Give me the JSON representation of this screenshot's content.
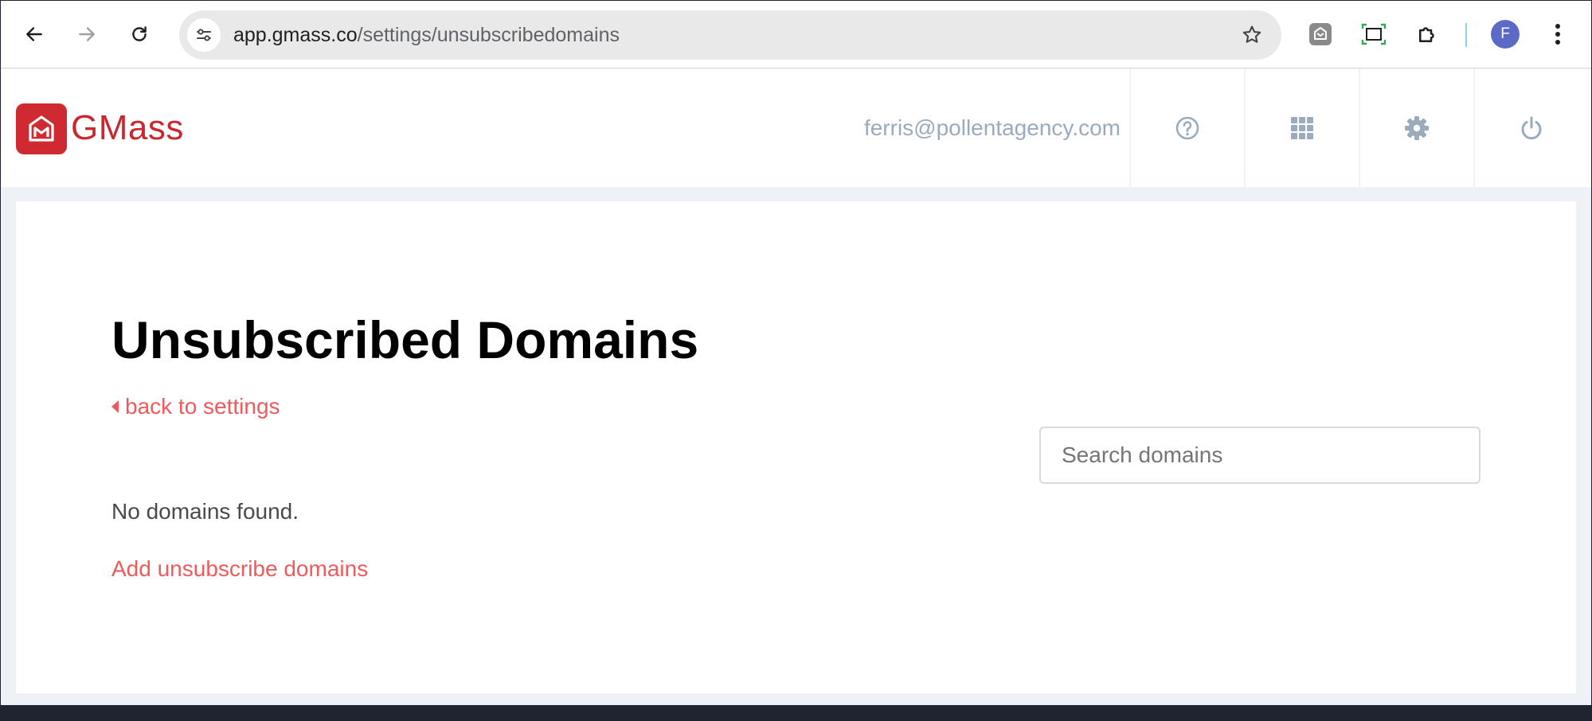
{
  "browser": {
    "url_host": "app.gmass.co",
    "url_path": "/settings/unsubscribedomains",
    "profile_initial": "F",
    "profile_color": "#5b6ac4"
  },
  "header": {
    "logo_text": "GMass",
    "user_email": "ferris@pollentagency.com",
    "icons": [
      "help-circle-icon",
      "apps-grid-icon",
      "gear-icon",
      "power-icon"
    ]
  },
  "page": {
    "title": "Unsubscribed Domains",
    "back_link": "back to settings",
    "search_placeholder": "Search domains",
    "empty_message": "No domains found.",
    "add_link": "Add unsubscribe domains"
  },
  "colors": {
    "brand_red": "#c8282e",
    "link_red": "#ef5a5a",
    "email_gray": "#9aabbd",
    "page_bg": "#eef2f6"
  }
}
